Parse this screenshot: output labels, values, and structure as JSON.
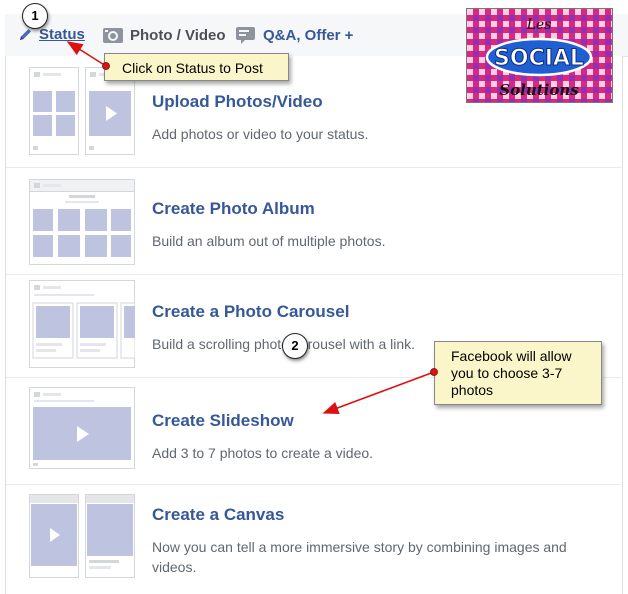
{
  "composer": {
    "tabs": [
      {
        "label": "Status",
        "icon": "pencil-icon"
      },
      {
        "label": "Photo / Video",
        "icon": "camera-icon"
      },
      {
        "label": "Q&A, Offer +",
        "icon": "chat-icon"
      }
    ]
  },
  "options": [
    {
      "title": "Upload Photos/Video",
      "description": "Add photos or video to your status."
    },
    {
      "title": "Create Photo Album",
      "description": "Build an album out of multiple photos."
    },
    {
      "title": "Create a Photo Carousel",
      "description": "Build a scrolling photo carousel with a link."
    },
    {
      "title": "Create Slideshow",
      "description": "Add 3 to 7 photos to create a video."
    },
    {
      "title": "Create a Canvas",
      "description": "Now you can tell a more immersive story by combining images and videos."
    }
  ],
  "logo": {
    "line1": "Les",
    "line2": "SOCIAL",
    "line3": "Solutions"
  },
  "annotations": [
    {
      "number": "1",
      "text": "Click on Status to Post"
    },
    {
      "number": "2",
      "text": "Facebook will allow you to choose 3-7 photos"
    }
  ],
  "colors": {
    "link": "#365899",
    "thumb": "#bec3e0",
    "callout": "#fbf6c9",
    "arrow": "#dd1111"
  }
}
